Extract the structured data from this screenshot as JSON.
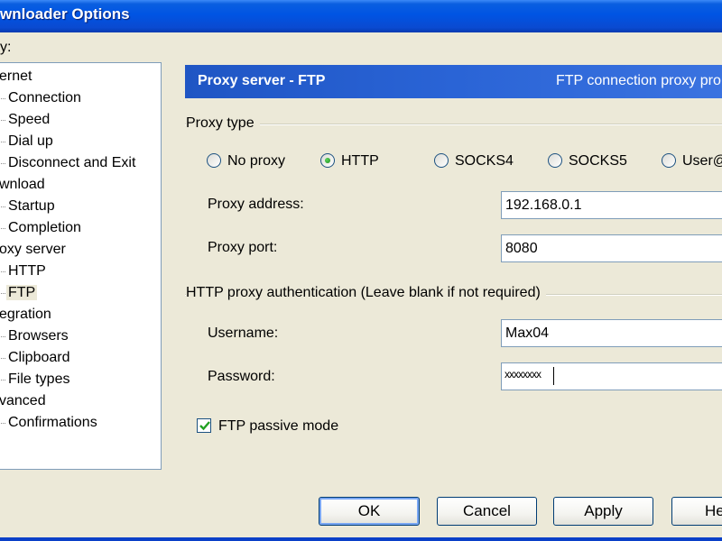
{
  "window": {
    "title": "wnloader Options"
  },
  "sidebar": {
    "caption": "y:",
    "items": [
      {
        "label": "ernet",
        "level": 0
      },
      {
        "label": "Connection",
        "level": 1
      },
      {
        "label": "Speed",
        "level": 1
      },
      {
        "label": "Dial up",
        "level": 1
      },
      {
        "label": "Disconnect and Exit",
        "level": 1
      },
      {
        "label": "wnload",
        "level": 0
      },
      {
        "label": "Startup",
        "level": 1
      },
      {
        "label": "Completion",
        "level": 1
      },
      {
        "label": "oxy server",
        "level": 0
      },
      {
        "label": "HTTP",
        "level": 1
      },
      {
        "label": "FTP",
        "level": 1,
        "selected": true
      },
      {
        "label": "egration",
        "level": 0
      },
      {
        "label": "Browsers",
        "level": 1
      },
      {
        "label": "Clipboard",
        "level": 1
      },
      {
        "label": "File types",
        "level": 1
      },
      {
        "label": "vanced",
        "level": 0
      },
      {
        "label": "Confirmations",
        "level": 1
      }
    ]
  },
  "panel": {
    "banner": {
      "title": "Proxy server - FTP",
      "description": "FTP connection proxy pro"
    },
    "proxy_type": {
      "label": "Proxy type",
      "options": [
        {
          "label": "No proxy",
          "selected": false
        },
        {
          "label": "HTTP",
          "selected": true
        },
        {
          "label": "SOCKS4",
          "selected": false
        },
        {
          "label": "SOCKS5",
          "selected": false
        },
        {
          "label": "User@",
          "selected": false
        }
      ]
    },
    "proxy_address": {
      "label": "Proxy address:",
      "value": "192.168.0.1"
    },
    "proxy_port": {
      "label": "Proxy port:",
      "value": "8080"
    },
    "auth": {
      "label": "HTTP proxy authentication (Leave blank if not required)",
      "username": {
        "label": "Username:",
        "value": "Max04"
      },
      "password": {
        "label": "Password:",
        "masked": "xxxxxxxx"
      }
    },
    "passive_mode": {
      "label": "FTP passive mode",
      "checked": true
    }
  },
  "buttons": {
    "ok": "OK",
    "cancel": "Cancel",
    "apply": "Apply",
    "help": "He"
  },
  "colors": {
    "titlebar": "#0054e3",
    "banner": "#2a64d6",
    "dialog_bg": "#ece9d8",
    "radio_dot": "#1e8c1e",
    "check_tick": "#21a121"
  }
}
